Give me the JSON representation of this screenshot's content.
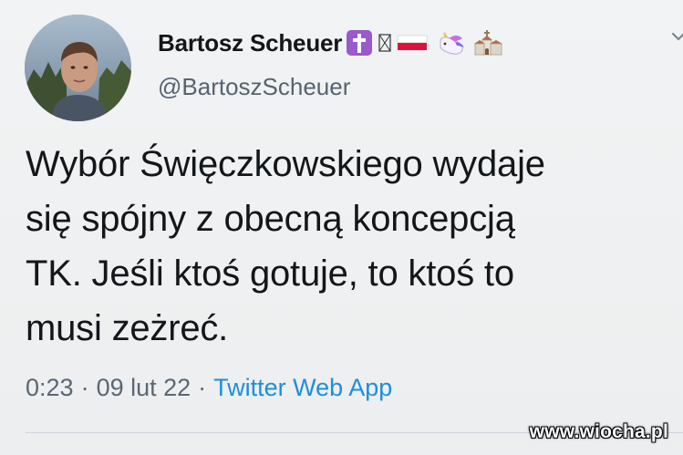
{
  "author": {
    "display_name": "Bartosz Scheuer",
    "handle": "@BartoszScheuer",
    "name_emojis": [
      "cross-emoji",
      "unknown-glyph-emoji",
      "poland-flag-emoji",
      "unicorn-emoji",
      "church-emoji"
    ]
  },
  "tweet": {
    "text": "Wybór Święczkowskiego wydaje\nsię spójny z obecną koncepcją\nTK. Jeśli ktoś gotuje, to ktoś to\nmusi zeżreć.",
    "time": "0:23",
    "date": "09 lut 22",
    "separator": "·",
    "source": "Twitter Web App"
  },
  "watermark": "www.wiocha.pl",
  "colors": {
    "text": "#14171a",
    "secondary": "#566370",
    "link": "#1d8fd9",
    "background": "#eef0f1"
  }
}
